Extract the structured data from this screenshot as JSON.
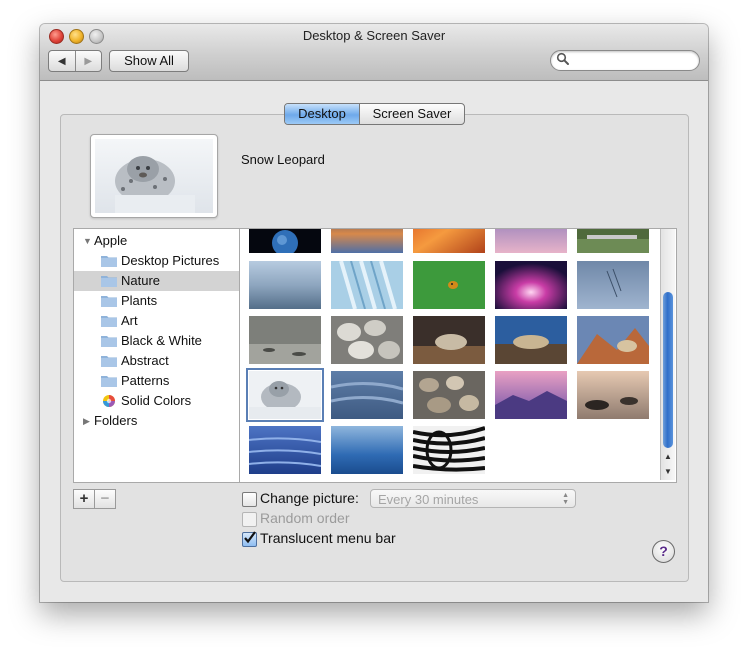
{
  "window": {
    "title": "Desktop & Screen Saver"
  },
  "toolbar": {
    "back_icon": "◀",
    "forward_icon": "▶",
    "show_all_label": "Show All",
    "search_placeholder": "",
    "search_value": ""
  },
  "tabs": [
    {
      "label": "Desktop",
      "active": true
    },
    {
      "label": "Screen Saver",
      "active": false
    }
  ],
  "preview": {
    "name": "Snow Leopard"
  },
  "sidebar": {
    "items": [
      {
        "label": "Apple",
        "level": 0,
        "expanded": true
      },
      {
        "label": "Desktop Pictures",
        "level": 1,
        "icon": "folder-icon"
      },
      {
        "label": "Nature",
        "level": 1,
        "icon": "folder-icon",
        "selected": true
      },
      {
        "label": "Plants",
        "level": 1,
        "icon": "folder-icon"
      },
      {
        "label": "Art",
        "level": 1,
        "icon": "folder-icon"
      },
      {
        "label": "Black & White",
        "level": 1,
        "icon": "folder-icon"
      },
      {
        "label": "Abstract",
        "level": 1,
        "icon": "folder-icon"
      },
      {
        "label": "Patterns",
        "level": 1,
        "icon": "folder-icon"
      },
      {
        "label": "Solid Colors",
        "level": 1,
        "icon": "color-wheel-icon"
      },
      {
        "label": "Folders",
        "level": 0,
        "expanded": false
      }
    ]
  },
  "buttons": {
    "add": "+",
    "remove": "−"
  },
  "options": {
    "change_picture": {
      "label": "Change picture:",
      "checked": false
    },
    "interval": {
      "value": "Every 30 minutes",
      "enabled": false
    },
    "random_order": {
      "label": "Random order",
      "checked": false,
      "enabled": false
    },
    "translucent_menu_bar": {
      "label": "Translucent menu bar",
      "checked": true
    }
  },
  "help": {
    "label": "?"
  },
  "colors": {
    "tab_active": "#6ea9ea",
    "scroll_knob": "#2f6fca",
    "sidebar_selection": "#d3d3d3"
  }
}
